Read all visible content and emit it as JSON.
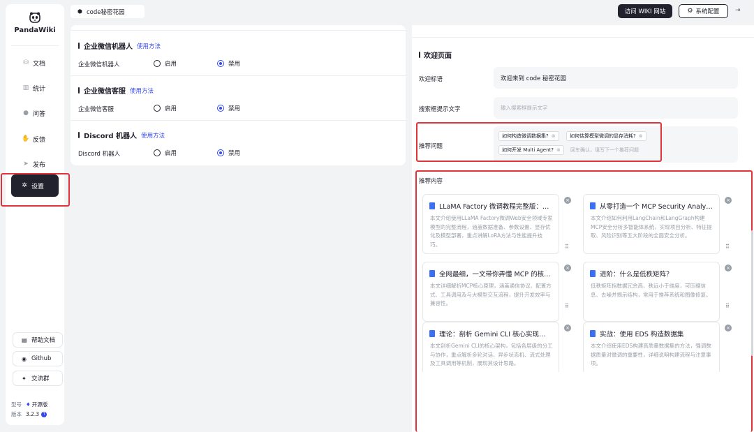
{
  "app": {
    "name": "PandaWiki"
  },
  "sidebar": {
    "items": [
      {
        "label": "文档",
        "icon": "document-icon"
      },
      {
        "label": "统计",
        "icon": "chart-icon"
      },
      {
        "label": "问答",
        "icon": "chat-icon"
      },
      {
        "label": "反馈",
        "icon": "feedback-icon"
      },
      {
        "label": "发布",
        "icon": "send-icon"
      },
      {
        "label": "设置",
        "icon": "gear-icon",
        "active": true
      }
    ],
    "links": [
      {
        "label": "帮助文档",
        "icon": "help-doc-icon"
      },
      {
        "label": "Github",
        "icon": "github-icon"
      },
      {
        "label": "交流群",
        "icon": "group-icon"
      }
    ],
    "model_label": "型号",
    "model_value": "开源版",
    "version_label": "版本",
    "version_value": "3.2.3"
  },
  "header": {
    "kb_name": "code秘密花园",
    "visit_button": "访问 WIKI 网站",
    "config_button": "系统配置"
  },
  "bots": [
    {
      "title": "企业微信机器人",
      "link": "使用方法",
      "row_label": "企业微信机器人",
      "enable": "启用",
      "disable": "禁用",
      "selected": "禁用"
    },
    {
      "title": "企业微信客服",
      "link": "使用方法",
      "row_label": "企业微信客服",
      "enable": "启用",
      "disable": "禁用",
      "selected": "禁用"
    },
    {
      "title": "Discord 机器人",
      "link": "使用方法",
      "row_label": "Discord 机器人",
      "enable": "启用",
      "disable": "禁用",
      "selected": "禁用"
    }
  ],
  "welcome": {
    "section_title": "欢迎页面",
    "welcome_label": "欢迎标语",
    "welcome_value": "欢迎来到 code 秘密花园",
    "search_label": "搜索框提示文字",
    "search_placeholder": "输入搜索框提示文字",
    "questions_label": "推荐问题",
    "questions": [
      "如何构造微调数据集?",
      "如何估算模型微调的显存消耗?",
      "如何开发 Multi Agent?"
    ],
    "questions_placeholder": "回车确认，填写下一个推荐问题",
    "content_label": "推荐内容",
    "cards": [
      {
        "title": "LLaMA Factory 微调教程完整版：从入门到...",
        "desc": "本文介绍使用LLaMA Factory微调Web安全领域专家模型的完整流程，涵盖数据准备、参数设置、显存优化及模型部署，重点讲解LoRA方法与性能提升技巧。"
      },
      {
        "title": "从零打造一个 MCP Security Analyzer",
        "desc": "本文介绍如何利用LangChain和LangGraph构建MCP安全分析多智能体系统，实现项目分析、特征提取、风险识别等五大阶段的全面安全分析。"
      },
      {
        "title": "全网最细，一文带你弄懂 MCP 的核心原理",
        "desc": "本文详细解析MCP核心原理，涵盖通信协议、配置方式、工具调用及与大模型交互流程，提升开发效率与兼容性。"
      },
      {
        "title": "进阶：什么是低秩矩阵？",
        "desc": "低秩矩阵指数据冗余高、秩远小于维度，可压缩信息、去噪并揭示结构，常用于推荐系统和图像修复。"
      },
      {
        "title": "理论：剖析 Gemini CLI 核心实现原理",
        "desc": "本文剖析Gemini CLI的核心架构，包括各层级的分工与协作，重点解析多轮对话、异步状态机、流式处理及工具调用等机制，展现其设计思路。"
      },
      {
        "title": "实战：使用 EDS 构造数据集",
        "desc": "本文介绍使用EDS构建高质量数据集的方法，强调数据质量对微调的重要性，详细说明构建流程与注意事项。"
      }
    ]
  }
}
